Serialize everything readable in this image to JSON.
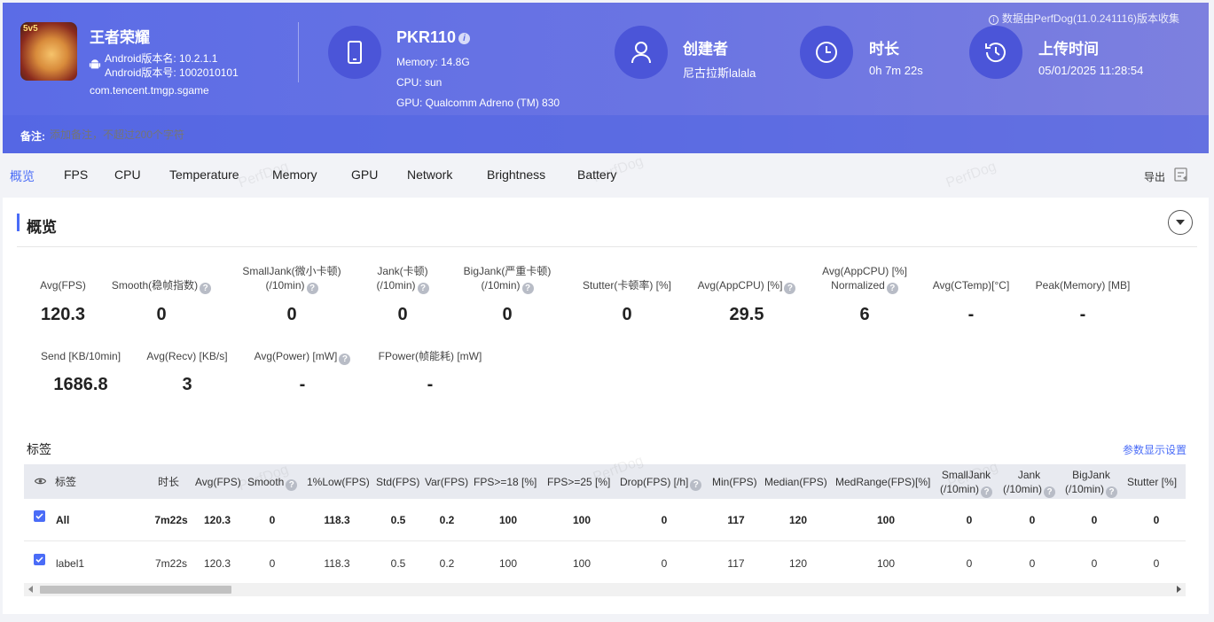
{
  "header": {
    "app_name": "王者荣耀",
    "android_version_name": "Android版本名: 10.2.1.1",
    "android_version_code": "Android版本号: 1002010101",
    "package": "com.tencent.tmgp.sgame",
    "icon_badge": "5v5",
    "device_name": "PKR110",
    "memory": "Memory: 14.8G",
    "cpu": "CPU: sun",
    "gpu": "GPU: Qualcomm Adreno (TM) 830",
    "creator_title": "创建者",
    "creator_value": "尼古拉斯lalala",
    "duration_title": "时长",
    "duration_value": "0h 7m 22s",
    "upload_title": "上传时间",
    "upload_value": "05/01/2025 11:28:54",
    "source_note": "数据由PerfDog(11.0.241116)版本收集",
    "note_label": "备注:",
    "note_placeholder": "添加备注，不超过200个字符",
    "accent": "#5b6ce6"
  },
  "tabs": [
    "概览",
    "FPS",
    "CPU",
    "Temperature",
    "Memory",
    "GPU",
    "Network",
    "Brightness",
    "Battery"
  ],
  "export_label": "导出",
  "watermark": "PerfDog",
  "overview": {
    "title": "概览",
    "metrics": [
      {
        "label1": "Avg(FPS)",
        "label2": "",
        "value": "120.3"
      },
      {
        "label1": "Smooth(稳帧指数)",
        "label2": "",
        "value": "0"
      },
      {
        "label1": "SmallJank(微小卡顿)",
        "label2": "(/10min)",
        "value": "0"
      },
      {
        "label1": "Jank(卡顿)",
        "label2": "(/10min)",
        "value": "0"
      },
      {
        "label1": "BigJank(严重卡顿)",
        "label2": "(/10min)",
        "value": "0"
      },
      {
        "label1": "Stutter(卡顿率) [%]",
        "label2": "",
        "value": "0"
      },
      {
        "label1": "Avg(AppCPU) [%]",
        "label2": "",
        "value": "29.5"
      },
      {
        "label1": "Avg(AppCPU) [%]",
        "label2": "Normalized",
        "value": "6"
      },
      {
        "label1": "Avg(CTemp)[°C]",
        "label2": "",
        "value": "-"
      },
      {
        "label1": "Peak(Memory) [MB]",
        "label2": "",
        "value": "-"
      },
      {
        "label1": "Send [KB/10min]",
        "label2": "",
        "value": "1686.8"
      },
      {
        "label1": "Avg(Recv) [KB/s]",
        "label2": "",
        "value": "3"
      },
      {
        "label1": "Avg(Power) [mW]",
        "label2": "",
        "value": "-"
      },
      {
        "label1": "FPower(帧能耗) [mW]",
        "label2": "",
        "value": "-"
      }
    ]
  },
  "labels_table": {
    "title": "标签",
    "settings_link": "参数显示设置",
    "headers": [
      "标签",
      "时长",
      "Avg(FPS)",
      "Smooth",
      "1%Low(FPS)",
      "Std(FPS)",
      "Var(FPS)",
      "FPS>=18 [%]",
      "FPS>=25 [%]",
      "Drop(FPS) [/h]",
      "Min(FPS)",
      "Median(FPS)",
      "MedRange(FPS)[%]",
      "SmallJank",
      "(/10min)",
      "Jank",
      "(/10min)",
      "BigJank",
      "(/10min)",
      "Stutter [%]"
    ],
    "rows": [
      {
        "name": "All",
        "cells": [
          "7m22s",
          "120.3",
          "0",
          "118.3",
          "0.5",
          "0.2",
          "100",
          "100",
          "0",
          "117",
          "120",
          "100",
          "0",
          "0",
          "0",
          "0"
        ]
      },
      {
        "name": "label1",
        "cells": [
          "7m22s",
          "120.3",
          "0",
          "118.3",
          "0.5",
          "0.2",
          "100",
          "100",
          "0",
          "117",
          "120",
          "100",
          "0",
          "0",
          "0",
          "0"
        ]
      }
    ]
  }
}
